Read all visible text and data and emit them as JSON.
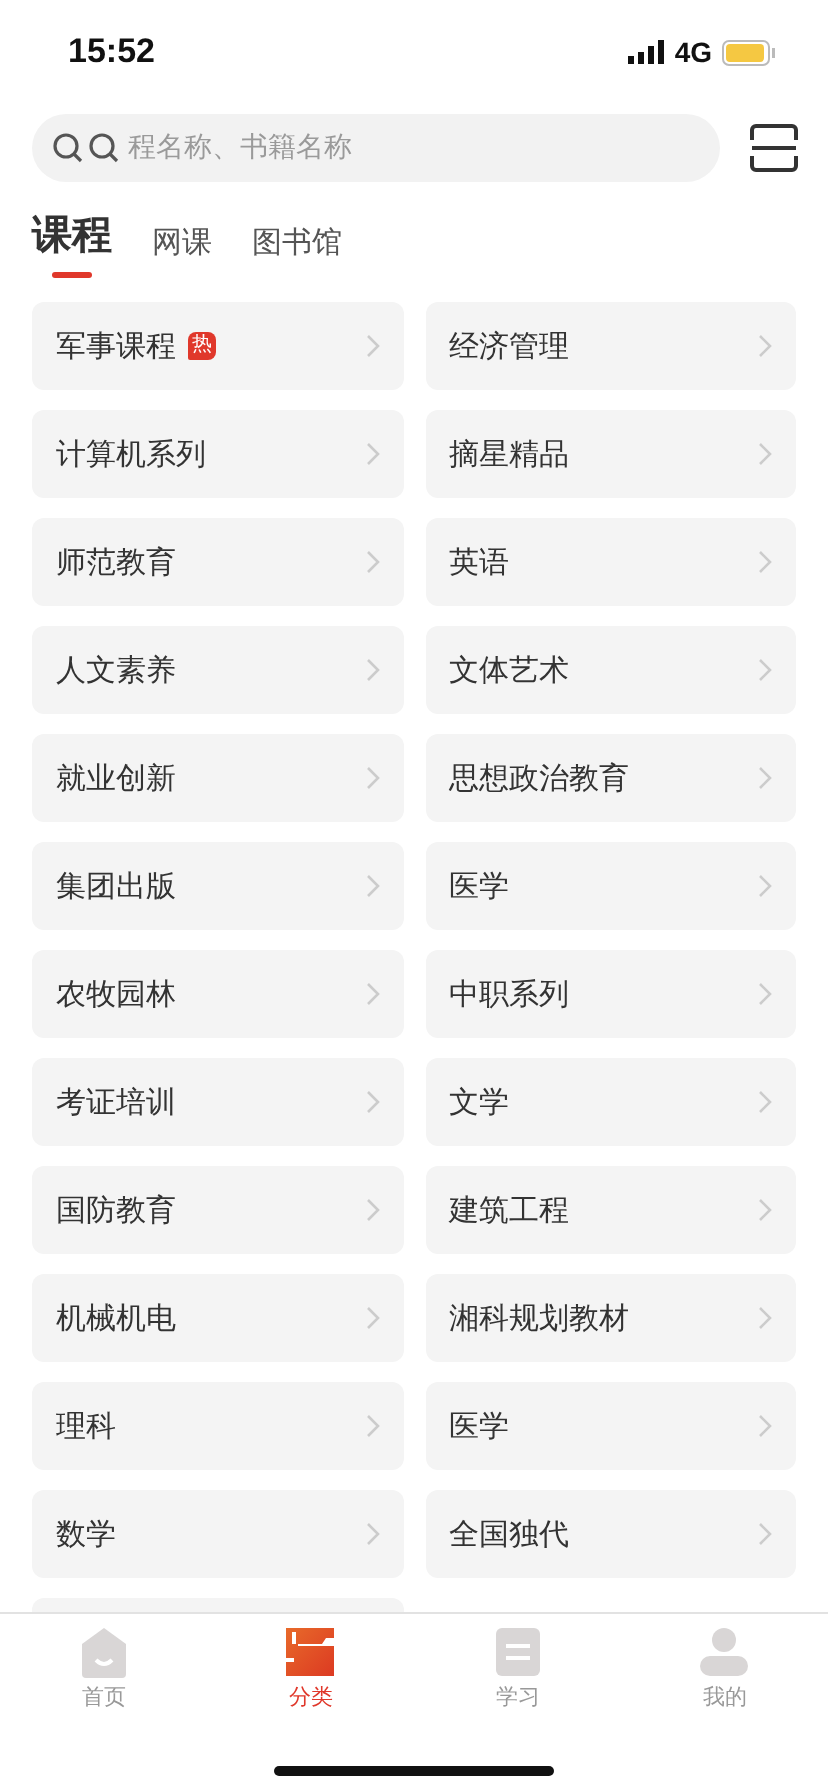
{
  "status_bar": {
    "time": "15:52",
    "network": "4G"
  },
  "search": {
    "placeholder": "程名称、书籍名称"
  },
  "tabs": [
    {
      "label": "课程",
      "selected": true
    },
    {
      "label": "网课",
      "selected": false
    },
    {
      "label": "图书馆",
      "selected": false
    }
  ],
  "categories": [
    {
      "label": "军事课程",
      "badge": "热"
    },
    {
      "label": "经济管理"
    },
    {
      "label": "计算机系列"
    },
    {
      "label": "摘星精品"
    },
    {
      "label": "师范教育"
    },
    {
      "label": "英语"
    },
    {
      "label": "人文素养"
    },
    {
      "label": "文体艺术"
    },
    {
      "label": "就业创新"
    },
    {
      "label": "思想政治教育"
    },
    {
      "label": "集团出版"
    },
    {
      "label": "医学"
    },
    {
      "label": "农牧园林"
    },
    {
      "label": "中职系列"
    },
    {
      "label": "考证培训"
    },
    {
      "label": "文学"
    },
    {
      "label": "国防教育"
    },
    {
      "label": "建筑工程"
    },
    {
      "label": "机械机电"
    },
    {
      "label": "湘科规划教材"
    },
    {
      "label": "理科"
    },
    {
      "label": "医学"
    },
    {
      "label": "数学"
    },
    {
      "label": "全国独代"
    }
  ],
  "bottom_nav": [
    {
      "kind": "home",
      "label": "首页",
      "selected": false
    },
    {
      "kind": "category",
      "label": "分类",
      "selected": true
    },
    {
      "kind": "study",
      "label": "学习",
      "selected": false
    },
    {
      "kind": "profile",
      "label": "我的",
      "selected": false
    }
  ]
}
